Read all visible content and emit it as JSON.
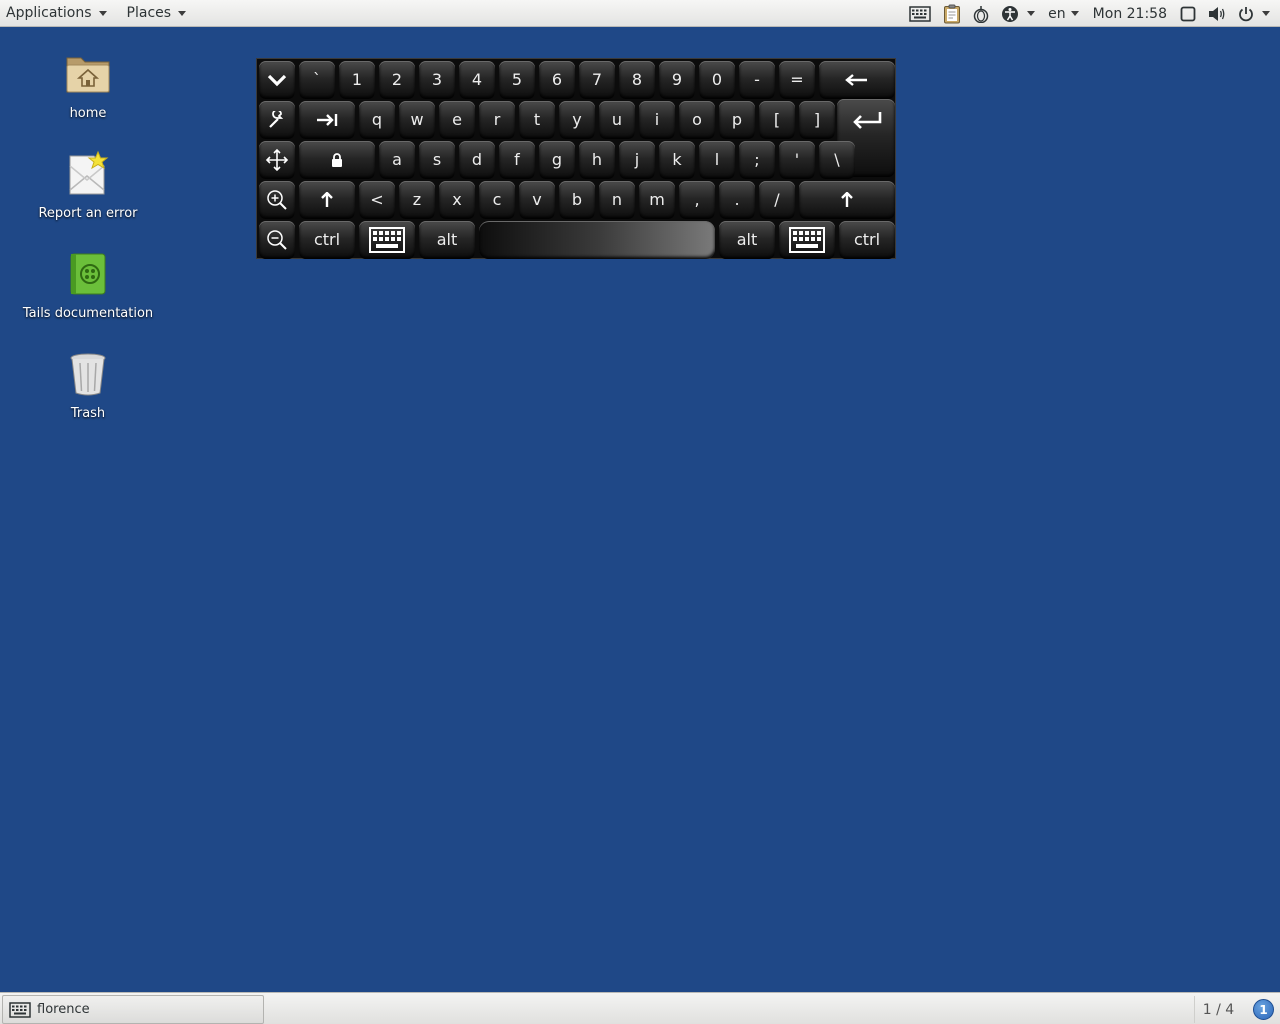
{
  "top_panel": {
    "applications_label": "Applications",
    "places_label": "Places",
    "tray": {
      "language": "en",
      "clock": "Mon 21:58"
    }
  },
  "desktop_icons": [
    {
      "label": "home",
      "icon": "folder-home-icon"
    },
    {
      "label": "Report an error",
      "icon": "report-error-icon"
    },
    {
      "label": "Tails documentation",
      "icon": "documentation-book-icon"
    },
    {
      "label": "Trash",
      "icon": "trash-icon"
    }
  ],
  "keyboard": {
    "row1": [
      "`",
      "1",
      "2",
      "3",
      "4",
      "5",
      "6",
      "7",
      "8",
      "9",
      "0",
      "-",
      "="
    ],
    "row2": [
      "q",
      "w",
      "e",
      "r",
      "t",
      "y",
      "u",
      "i",
      "o",
      "p",
      "[",
      "]"
    ],
    "row3": [
      "a",
      "s",
      "d",
      "f",
      "g",
      "h",
      "j",
      "k",
      "l",
      ";",
      "'",
      "\\"
    ],
    "row4": [
      "<",
      "z",
      "x",
      "c",
      "v",
      "b",
      "n",
      "m",
      ",",
      ".",
      "/"
    ],
    "ctrl_left": "ctrl",
    "alt_left": "alt",
    "alt_right": "alt",
    "ctrl_right": "ctrl"
  },
  "bottom_panel": {
    "task_label": "florence",
    "workspace": "1 / 4",
    "notification_count": "1"
  }
}
